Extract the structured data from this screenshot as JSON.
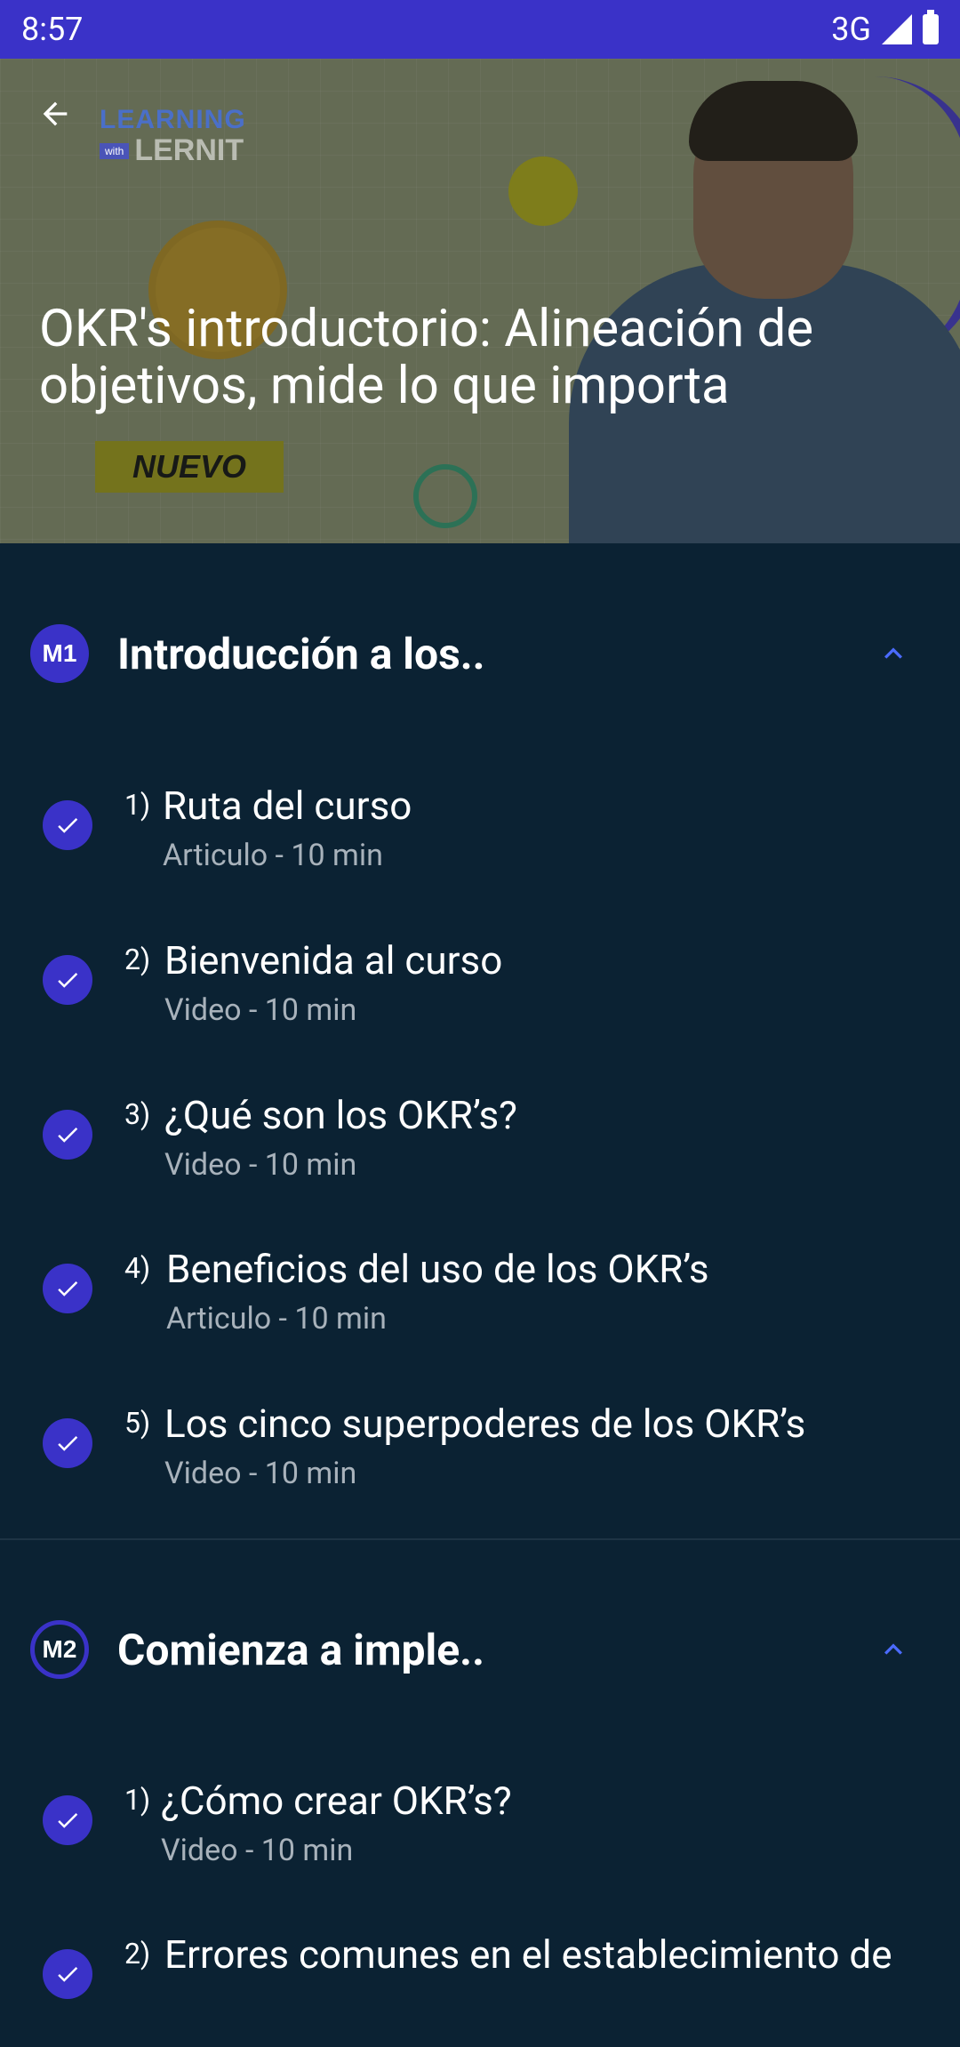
{
  "status_bar": {
    "time": "8:57",
    "network": "3G"
  },
  "hero": {
    "logo_top": "LEARNING",
    "logo_with": "with",
    "logo_brand": "LERNIT",
    "tag": "NUEVO",
    "title": "OKR's introductorio: Alineación de objetivos, mide lo que importa"
  },
  "modules": [
    {
      "badge": "M1",
      "title": "Introducción a los..",
      "lessons": [
        {
          "num": "1)",
          "title": "Ruta del curso",
          "meta": "Articulo - 10 min"
        },
        {
          "num": "2)",
          "title": "Bienvenida al curso",
          "meta": "Video - 10 min"
        },
        {
          "num": "3)",
          "title": "¿Qué son los OKR’s?",
          "meta": "Video - 10 min"
        },
        {
          "num": "4)",
          "title": "Beneficios del uso de los OKR’s",
          "meta": "Articulo - 10 min"
        },
        {
          "num": "5)",
          "title": "Los cinco superpoderes de los OKR’s",
          "meta": "Video - 10 min"
        }
      ]
    },
    {
      "badge": "M2",
      "title": "Comienza a imple..",
      "lessons": [
        {
          "num": "1)",
          "title": "¿Cómo crear OKR’s?",
          "meta": "Video - 10 min"
        },
        {
          "num": "2)",
          "title": "Errores comunes en el establecimiento de",
          "meta": ""
        }
      ]
    }
  ],
  "colors": {
    "accent": "#3a32c8",
    "background": "#0b2233",
    "meta_text": "#a8b2bb",
    "chevron": "#4b6bff"
  }
}
